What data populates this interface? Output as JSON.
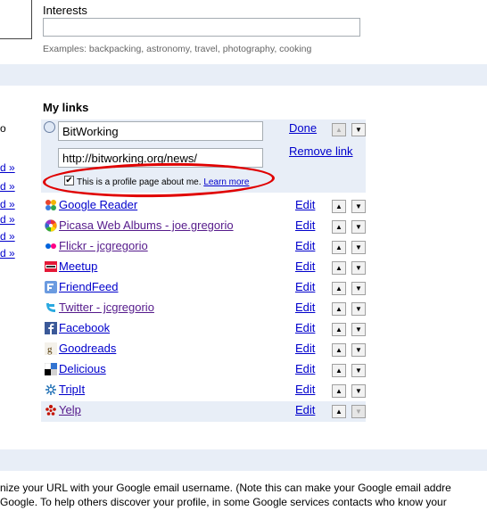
{
  "interests": {
    "label": "Interests",
    "value": "",
    "example": "Examples: backpacking, astronomy, travel, photography, cooking"
  },
  "left_column": {
    "o_text": "o",
    "links": [
      "d »",
      "d »",
      "d »",
      "d »",
      "d »",
      "d »"
    ]
  },
  "my_links": {
    "title": "My links",
    "editing": {
      "name_value": "BitWorking",
      "url_value": "http://bitworking.org/news/",
      "done_label": "Done",
      "remove_label": "Remove link",
      "profile_checked": true,
      "profile_text": "This is a profile page about me.",
      "learn_more": "Learn more"
    },
    "edit_label": "Edit",
    "items": [
      {
        "name": "Google Reader",
        "icon": "google-reader-icon"
      },
      {
        "name": "Picasa Web Albums - joe.gregorio",
        "icon": "picasa-icon"
      },
      {
        "name": "Flickr - jcgregorio",
        "icon": "flickr-icon"
      },
      {
        "name": "Meetup",
        "icon": "meetup-icon"
      },
      {
        "name": "FriendFeed",
        "icon": "friendfeed-icon"
      },
      {
        "name": "Twitter - jcgregorio",
        "icon": "twitter-icon"
      },
      {
        "name": "Facebook",
        "icon": "facebook-icon"
      },
      {
        "name": "Goodreads",
        "icon": "goodreads-icon"
      },
      {
        "name": "Delicious",
        "icon": "delicious-icon"
      },
      {
        "name": "TripIt",
        "icon": "tripit-icon"
      },
      {
        "name": "Yelp",
        "icon": "yelp-icon"
      }
    ]
  },
  "bottom": {
    "line1": "nize your URL with your Google email username. (Note this can make your Google email addre",
    "line2": "Google. To help others discover your profile, in some Google services contacts who know your"
  },
  "colors": {
    "link": "#0000cc",
    "visited": "#551a8b",
    "band": "#e8eef7",
    "highlight_circle": "#e00000"
  }
}
